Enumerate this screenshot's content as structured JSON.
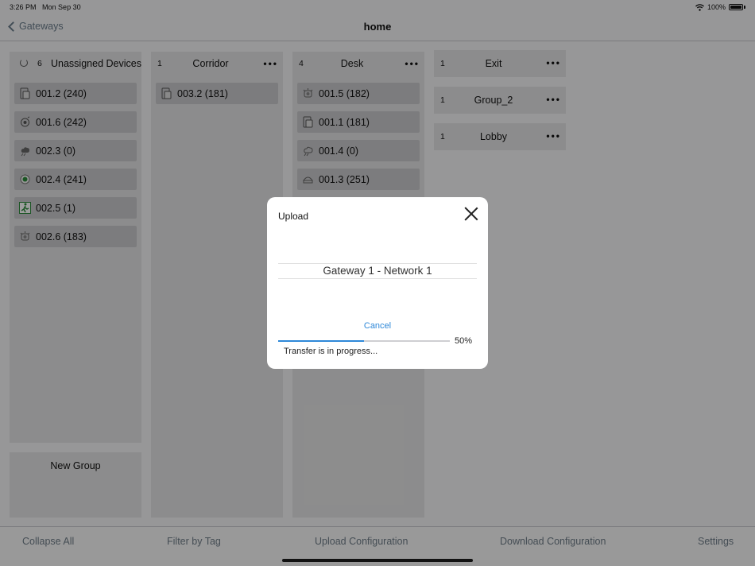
{
  "status_bar": {
    "time": "3:26 PM",
    "date": "Mon Sep 30",
    "battery": "100%",
    "icons": [
      "wifi-icon",
      "battery-icon"
    ]
  },
  "nav": {
    "back_label": "Gateways",
    "title": "home"
  },
  "columns": {
    "unassigned": {
      "count": "6",
      "title": "Unassigned Devices",
      "devices": [
        {
          "label": "001.2 (240)",
          "icon": "switch-icon"
        },
        {
          "label": "001.6 (242)",
          "icon": "sensor-icon"
        },
        {
          "label": "002.3 (0)",
          "icon": "cloud-sensor-icon"
        },
        {
          "label": "002.4 (241)",
          "icon": "green-sensor-icon"
        },
        {
          "label": "002.5 (1)",
          "icon": "exit-sign-icon"
        },
        {
          "label": "002.6 (183)",
          "icon": "multi-sensor-icon"
        }
      ]
    },
    "corridor": {
      "count": "1",
      "title": "Corridor",
      "devices": [
        {
          "label": "003.2 (181)",
          "icon": "switch-icon"
        }
      ]
    },
    "desk": {
      "count": "4",
      "title": "Desk",
      "devices": [
        {
          "label": "001.5 (182)",
          "icon": "multi-sensor-icon"
        },
        {
          "label": "001.1 (181)",
          "icon": "switch-icon"
        },
        {
          "label": "001.4 (0)",
          "icon": "cloud-sensor-icon"
        },
        {
          "label": "001.3 (251)",
          "icon": "dome-light-icon"
        }
      ]
    }
  },
  "groups": [
    {
      "count": "1",
      "title": "Exit"
    },
    {
      "count": "1",
      "title": "Group_2"
    },
    {
      "count": "1",
      "title": "Lobby"
    }
  ],
  "menu_glyph": "•••",
  "new_group_label": "New Group",
  "toolbar": {
    "collapse_all": "Collapse All",
    "filter_by_tag": "Filter by Tag",
    "upload_configuration": "Upload Configuration",
    "download_configuration": "Download Configuration",
    "settings": "Settings"
  },
  "modal": {
    "title": "Upload",
    "gateway": "Gateway 1 - Network 1",
    "cancel_label": "Cancel",
    "progress": 0.5,
    "progress_text": "50%",
    "status": "Transfer is in progress..."
  },
  "colors": {
    "accent": "#2e88d8",
    "nav_muted": "#6b7c8c",
    "card_bg": "#e3e3e4",
    "device_bg": "#c9c9cb"
  }
}
